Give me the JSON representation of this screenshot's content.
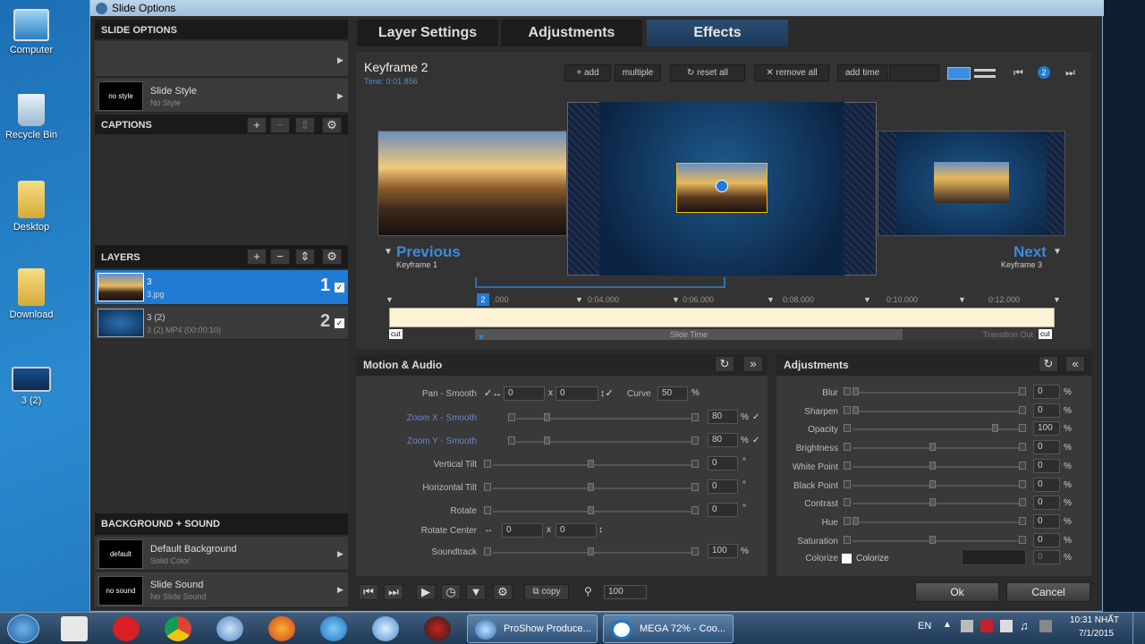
{
  "desktop": {
    "icons": [
      {
        "label": "Computer"
      },
      {
        "label": "Recycle Bin"
      },
      {
        "label": "Desktop"
      },
      {
        "label": "Download"
      },
      {
        "label": "3 (2)"
      }
    ]
  },
  "window": {
    "title": "Slide Options"
  },
  "left": {
    "slide_options_header": "SLIDE OPTIONS",
    "slide_style": {
      "thumb": "no style",
      "title": "Slide Style",
      "sub": "No Style"
    },
    "captions_header": "CAPTIONS",
    "layers_header": "LAYERS",
    "layers": [
      {
        "title": "3",
        "sub": "3.jpg",
        "num": "1"
      },
      {
        "title": "3 (2)",
        "sub": "3 (2).MP4 (00:00:10)",
        "num": "2"
      }
    ],
    "bg_sound_header": "BACKGROUND + SOUND",
    "background": {
      "thumb": "default",
      "title": "Default Background",
      "sub": "Solid Color"
    },
    "sound": {
      "thumb": "no sound",
      "title": "Slide Sound",
      "sub": "No Slide Sound"
    }
  },
  "tabs": [
    {
      "label": "Layer Settings"
    },
    {
      "label": "Adjustments"
    },
    {
      "label": "Effects"
    }
  ],
  "keyframe": {
    "title": "Keyframe 2",
    "time": "Time: 0:01.856",
    "buttons": {
      "add": "add",
      "multiple": "multiple",
      "reset_all": "reset all",
      "remove_all": "remove all",
      "add_time": "add time"
    },
    "nav_num": "2",
    "prev_label": "Previous",
    "prev_sub": "Keyframe 1",
    "next_label": "Next",
    "next_sub": "Keyframe 3",
    "marker": "2",
    "ticks": [
      "0:04.000",
      "0:06.000",
      "0:08.000",
      "0:10.000",
      "0:12.000"
    ],
    "tick_first": ".000",
    "slide_time": "Slide Time",
    "transition_out": "Transition Out",
    "cut_left": "cut",
    "cut_right": "cut"
  },
  "motion": {
    "header": "Motion & Audio",
    "pan_label": "Pan - Smooth",
    "pan_x": "0",
    "pan_y": "0",
    "curve_label": "Curve",
    "curve_val": "50",
    "zoomx_label": "Zoom X - Smooth",
    "zoomx_val": "80",
    "zoomy_label": "Zoom Y - Smooth",
    "zoomy_val": "80",
    "vtilt_label": "Vertical Tilt",
    "vtilt_val": "0",
    "htilt_label": "Horizontal Tilt",
    "htilt_val": "0",
    "rotate_label": "Rotate",
    "rotate_val": "0",
    "rc_label": "Rotate Center",
    "rc_x": "0",
    "rc_y": "0",
    "sound_label": "Soundtrack",
    "sound_val": "100",
    "pct": "%",
    "deg": "°",
    "x": "x"
  },
  "adjust": {
    "header": "Adjustments",
    "rows": [
      {
        "label": "Blur",
        "val": "0"
      },
      {
        "label": "Sharpen",
        "val": "0"
      },
      {
        "label": "Opacity",
        "val": "100"
      },
      {
        "label": "Brightness",
        "val": "0"
      },
      {
        "label": "White Point",
        "val": "0"
      },
      {
        "label": "Black Point",
        "val": "0"
      },
      {
        "label": "Contrast",
        "val": "0"
      },
      {
        "label": "Hue",
        "val": "0"
      },
      {
        "label": "Saturation",
        "val": "0"
      }
    ],
    "colorize_label": "Colorize",
    "colorize_check": "Colorize",
    "colorize_val": "0",
    "pct": "%"
  },
  "bottom": {
    "copy": "copy",
    "zoom": "100",
    "ok": "Ok",
    "cancel": "Cancel"
  },
  "taskbar": {
    "apps": [
      {
        "label": "ProShow Produce..."
      },
      {
        "label": "MEGA 72% - Coo..."
      }
    ],
    "lang": "EN",
    "time": "10:31 NHẤT",
    "date": "7/1/2015"
  },
  "colors": {
    "accent_blue": "#1f7bd4",
    "timeline": "#fdf3d4",
    "tab_active": "#2a4d72"
  }
}
